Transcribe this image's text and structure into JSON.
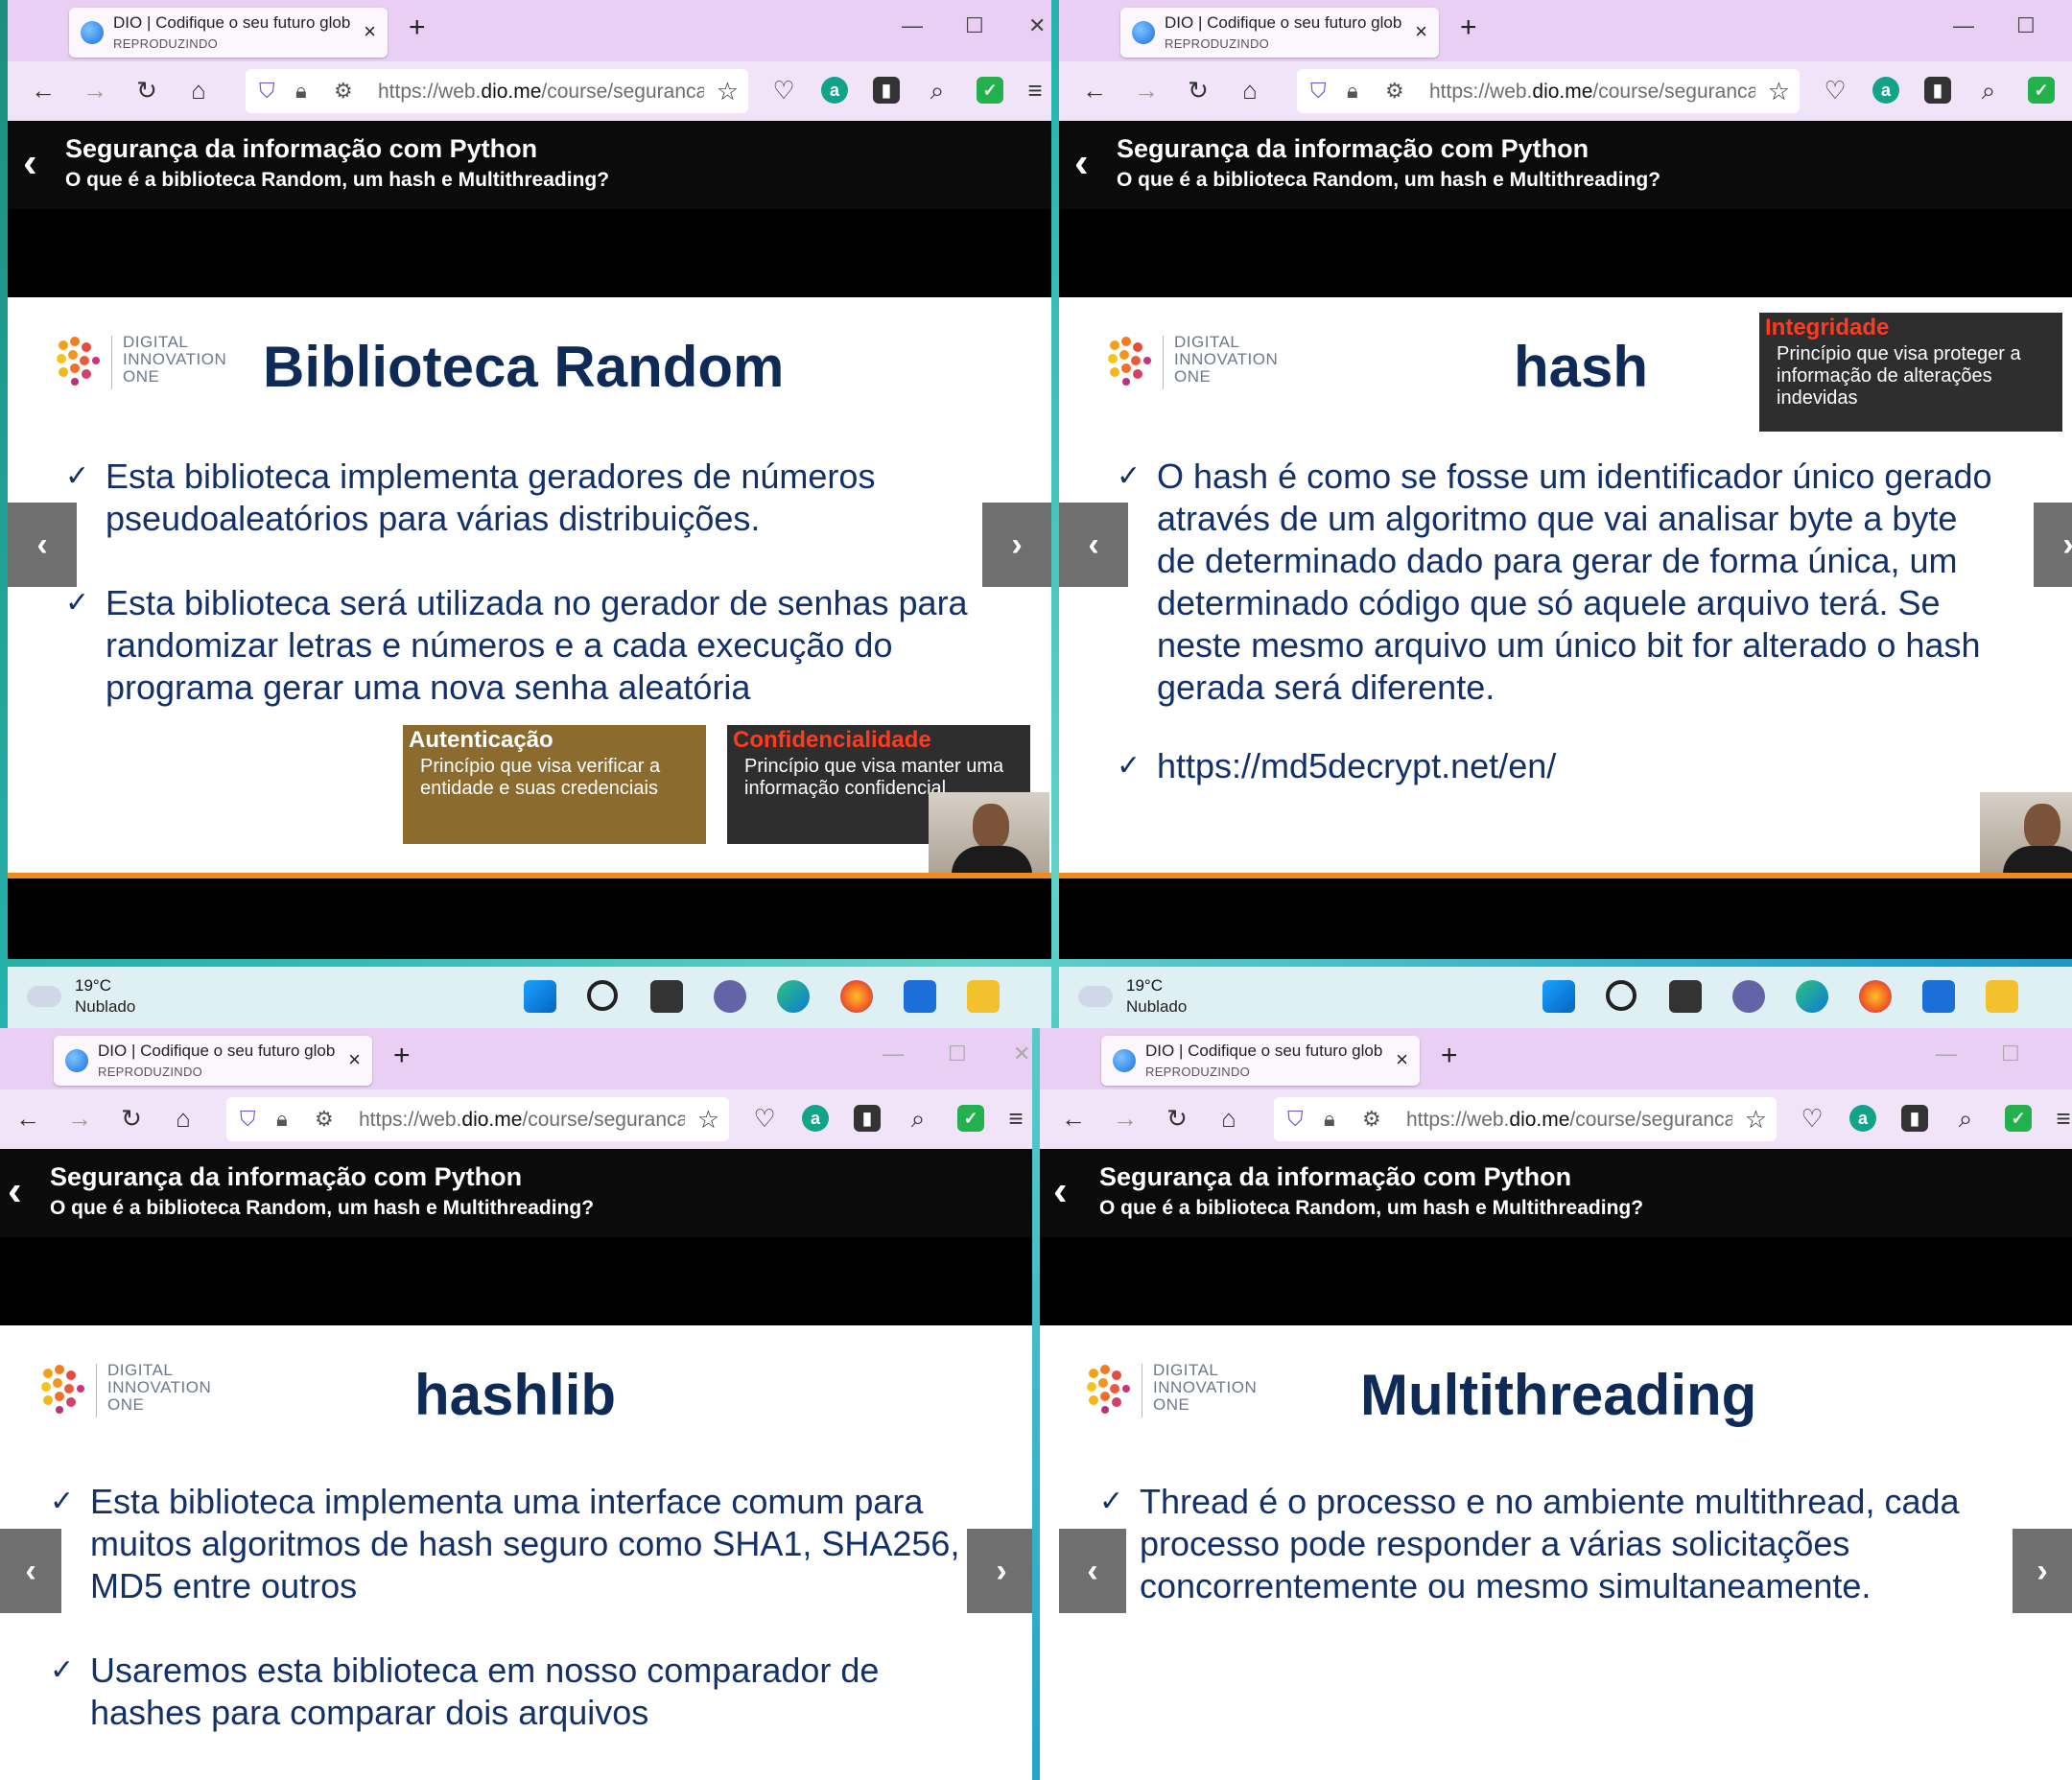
{
  "browser": {
    "tab_title": "DIO | Codifique o seu futuro global agora",
    "tab_status": "REPRODUZINDO",
    "url_prefix": "https://web.",
    "url_domain": "dio.me",
    "url_path": "/course/seguranca",
    "new_tab": "+",
    "close_tab": "×"
  },
  "course": {
    "title": "Segurança da informação com Python",
    "subtitle": "O que é a biblioteca Random, um hash e Multithreading?"
  },
  "logo": {
    "line1": "DIGITAL",
    "line2": "INNOVATION",
    "line3": "ONE"
  },
  "taskbar": {
    "temp": "19°C",
    "condition": "Nublado"
  },
  "slides": {
    "random": {
      "title": "Biblioteca Random",
      "bullets": [
        "Esta biblioteca  implementa geradores de números pseudoaleatórios para várias distribuições.",
        "Esta biblioteca será utilizada no gerador de senhas para randomizar letras e números e a cada execução do programa gerar uma nova senha aleatória"
      ],
      "box1_title": "Autenticação",
      "box1_text": "Princípio que visa verificar a entidade e suas credenciais",
      "box2_title": "Confidencialidade",
      "box2_text": "Princípio que visa manter uma informação confidencial"
    },
    "hash": {
      "title": "hash",
      "box_title": "Integridade",
      "box_text": "Princípio que visa proteger a informação de alterações indevidas",
      "bullets": [
        "O hash é como se fosse um identificador único gerado através de um algoritmo que vai analisar byte a byte de determinado dado para gerar de forma única, um determinado código que só aquele arquivo terá. Se neste mesmo arquivo um único bit for alterado o hash gerada será diferente.",
        "https://md5decrypt.net/en/"
      ]
    },
    "hashlib": {
      "title": "hashlib",
      "bullets": [
        "Esta biblioteca implementa uma interface comum para muitos algoritmos de hash seguro como SHA1, SHA256, MD5 entre outros",
        "Usaremos esta biblioteca em nosso comparador de hashes para comparar dois arquivos"
      ]
    },
    "multithreading": {
      "title": "Multithreading",
      "bullets": [
        "Thread é o processo e no ambiente multithread, cada processo pode responder a várias solicitações concorrentemente ou mesmo simultaneamente."
      ]
    }
  },
  "colors": {
    "title_navy": "#0e2b57",
    "bullet_navy": "#12306a",
    "accent_orange": "#f08a1c",
    "conf_red": "#ff3b1f",
    "auth_brown": "#8c6b2f"
  }
}
